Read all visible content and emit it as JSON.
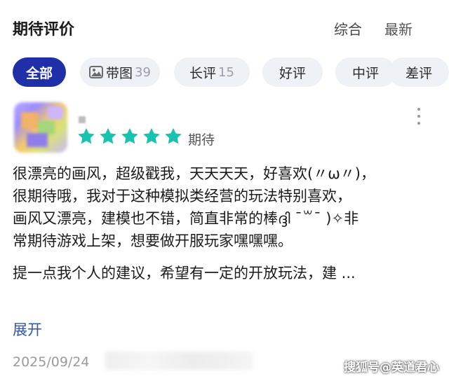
{
  "header": {
    "title": "期待评价",
    "sort_options": [
      "综合",
      "最新"
    ]
  },
  "filters": [
    {
      "label": "全部",
      "count": "",
      "active": true
    },
    {
      "label": "带图",
      "count": "39",
      "active": false
    },
    {
      "label": "长评",
      "count": "15",
      "active": false
    },
    {
      "label": "好评",
      "count": "",
      "active": false
    },
    {
      "label": "中评",
      "count": "",
      "active": false
    },
    {
      "label": "差评",
      "count": "",
      "active": false
    }
  ],
  "review": {
    "stars": 5,
    "rating_label": "期待",
    "lines": [
      "很漂亮的画风，超级戳我，天天天天，好喜欢(〃ω〃)，",
      "很期待哦，我对于这种模拟类经营的玩法特别喜欢，",
      "画风又漂亮，建模也不错，简直非常的棒ദ്ദി ˉ꒳ˉ )✧非",
      "常期待游戏上架，想要做开服玩家嘿嘿嘿。"
    ],
    "truncated_line": "提一点我个人的建议，希望有一定的开放玩法，建 ...",
    "expand_label": "展开",
    "date": "2025/09/24"
  },
  "watermark": "搜狐号@英道君心",
  "colors": {
    "active_chip": "#1f2fa8",
    "star": "#18c3b0",
    "link": "#2f59a8"
  }
}
